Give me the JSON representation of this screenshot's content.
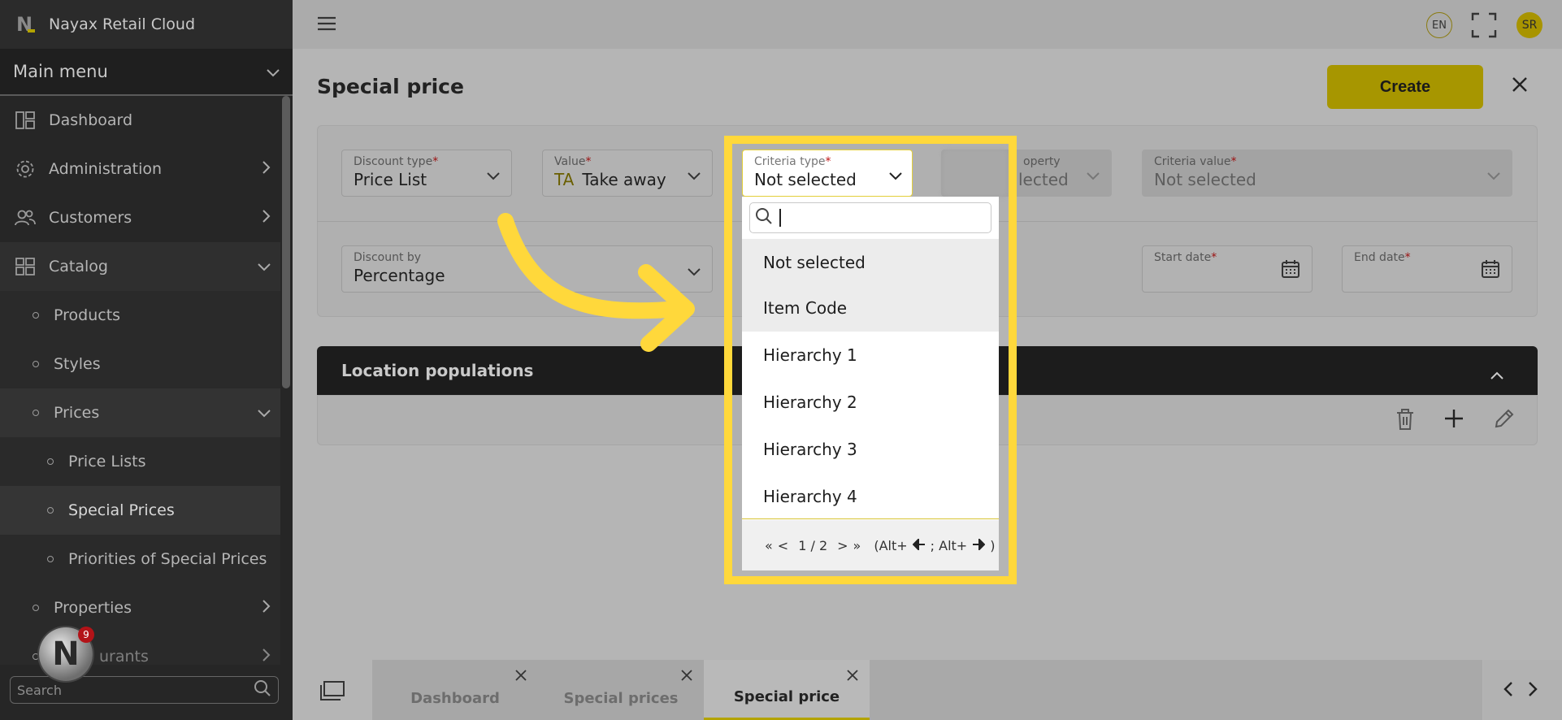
{
  "app": {
    "title": "Nayax Retail Cloud"
  },
  "sidebar": {
    "main_menu_label": "Main menu",
    "items": [
      {
        "label": "Dashboard"
      },
      {
        "label": "Administration"
      },
      {
        "label": "Customers"
      },
      {
        "label": "Catalog"
      },
      {
        "label": "Products"
      },
      {
        "label": "Styles"
      },
      {
        "label": "Prices"
      },
      {
        "label": "Price Lists"
      },
      {
        "label": "Special Prices"
      },
      {
        "label": "Priorities of Special Prices"
      },
      {
        "label": "Properties"
      },
      {
        "label": "urants"
      }
    ],
    "search_placeholder": "Search",
    "notification_count": "9"
  },
  "topbar": {
    "language": "EN",
    "user_initials": "SR"
  },
  "page": {
    "title": "Special price",
    "create_label": "Create"
  },
  "form": {
    "discount_type": {
      "label": "Discount type",
      "required": "*",
      "value": "Price List"
    },
    "value": {
      "label": "Value",
      "required": "*",
      "prefix": "TA",
      "value": "Take away"
    },
    "criteria_type": {
      "label": "Criteria type",
      "required": "*",
      "value": "Not selected"
    },
    "property": {
      "label": "operty",
      "value": "lected"
    },
    "criteria_value": {
      "label": "Criteria value",
      "required": "*",
      "value": "Not selected"
    },
    "discount_by": {
      "label": "Discount by",
      "value": "Percentage"
    },
    "start_date": {
      "label": "Start date",
      "required": "*"
    },
    "end_date": {
      "label": "End date",
      "required": "*"
    }
  },
  "location_populations": {
    "title": "Location populations"
  },
  "dropdown": {
    "options": [
      "Not selected",
      "Item Code",
      "Hierarchy 1",
      "Hierarchy 2",
      "Hierarchy 3",
      "Hierarchy 4"
    ],
    "pager": {
      "first": "«",
      "prev": "<",
      "page": "1 / 2",
      "next": ">",
      "last": "»",
      "hint_open": "(Alt+",
      "hint_mid": "; Alt+",
      "hint_close": ")"
    }
  },
  "tabs": [
    {
      "label": "Dashboard"
    },
    {
      "label": "Special prices"
    },
    {
      "label": "Special price"
    }
  ],
  "colors": {
    "accent": "#ffd83b",
    "create": "#a79600",
    "sidebar": "#262626",
    "header_dark": "#1c1c1c",
    "required": "#9b1010"
  }
}
